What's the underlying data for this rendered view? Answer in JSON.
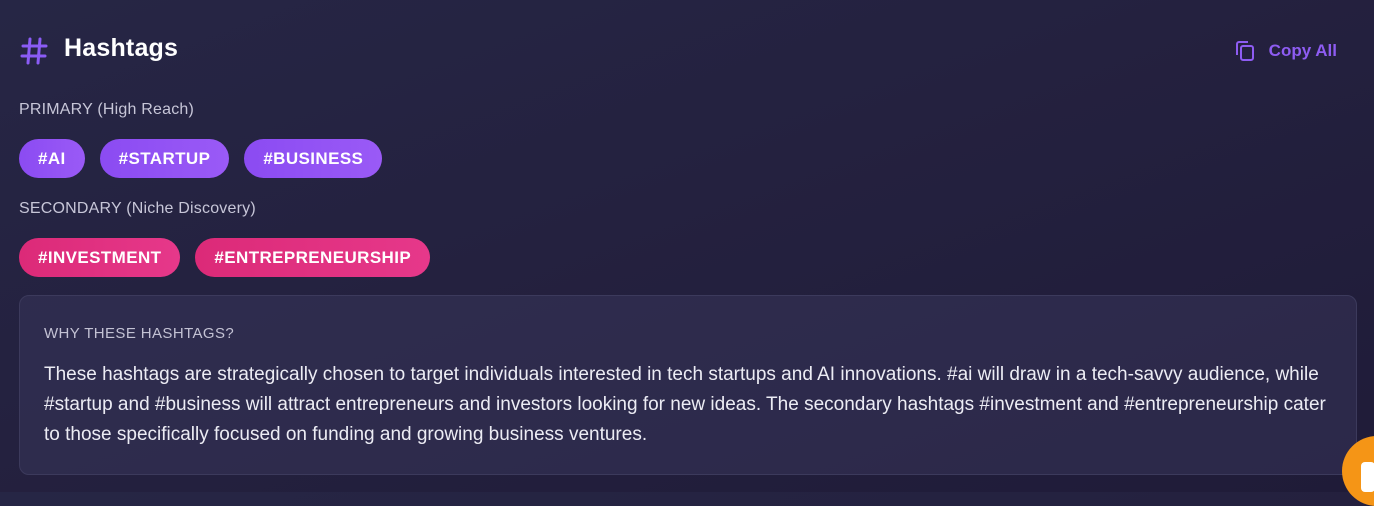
{
  "header": {
    "title": "Hashtags",
    "icon": "hash-icon",
    "copy_all": {
      "label": "Copy All",
      "icon": "copy-icon"
    }
  },
  "primary": {
    "label": "PRIMARY (High Reach)",
    "tags": [
      "#AI",
      "#STARTUP",
      "#BUSINESS"
    ]
  },
  "secondary": {
    "label": "SECONDARY (Niche Discovery)",
    "tags": [
      "#INVESTMENT",
      "#ENTREPRENEURSHIP"
    ]
  },
  "why": {
    "title": "WHY THESE HASHTAGS?",
    "text": "These hashtags are strategically chosen to target individuals interested in tech startups and AI innovations. #ai will draw in a tech-savvy audience, while #startup and #business will attract entrepreneurs and investors looking for new ideas. The secondary hashtags #investment and #entrepreneurship cater to those specifically focused on funding and growing business ventures."
  },
  "fab": {
    "icon": "chat-icon"
  },
  "colors": {
    "accent_purple": "#8b4bf2",
    "accent_pink": "#e0307f",
    "fab_orange": "#f59516",
    "background": "#24213f"
  }
}
